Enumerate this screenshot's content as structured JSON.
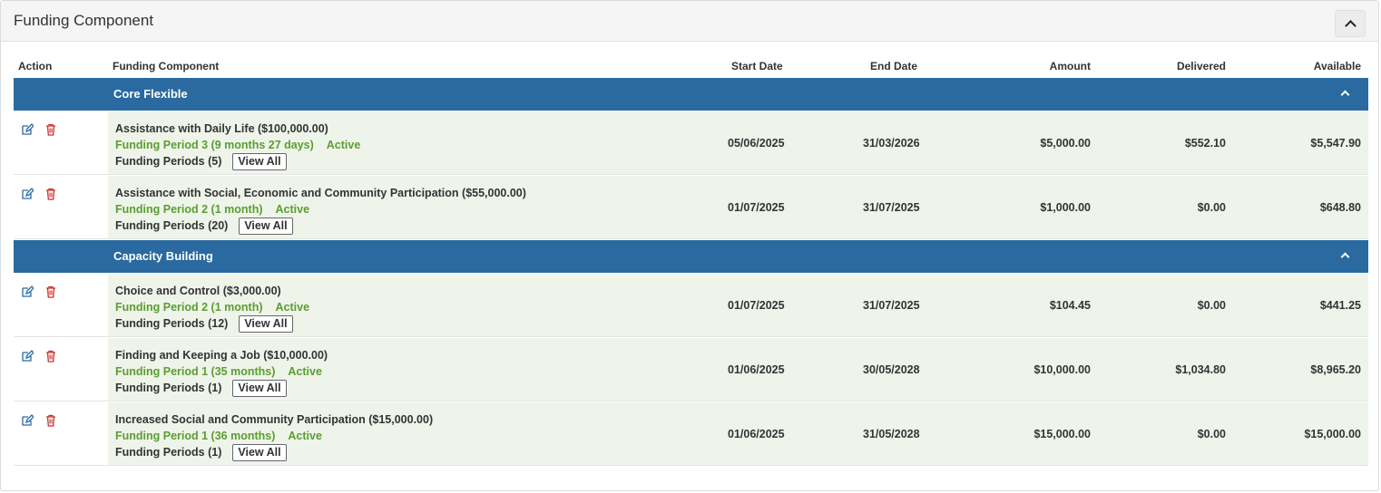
{
  "panel": {
    "title": "Funding Component"
  },
  "table": {
    "headers": {
      "action": "Action",
      "component": "Funding Component",
      "start": "Start Date",
      "end": "End Date",
      "amount": "Amount",
      "delivered": "Delivered",
      "available": "Available"
    },
    "groups": [
      {
        "label": "Core Flexible",
        "rows": [
          {
            "name": "Assistance with Daily Life ($100,000.00)",
            "period": "Funding Period 3 (9 months 27 days)",
            "status": "Active",
            "periods": "Funding Periods (5)",
            "view_all": "View All",
            "start": "05/06/2025",
            "end": "31/03/2026",
            "amount": "$5,000.00",
            "delivered": "$552.10",
            "available": "$5,547.90"
          },
          {
            "name": "Assistance with Social, Economic and Community Participation ($55,000.00)",
            "period": "Funding Period 2 (1 month)",
            "status": "Active",
            "periods": "Funding Periods (20)",
            "view_all": "View All",
            "start": "01/07/2025",
            "end": "31/07/2025",
            "amount": "$1,000.00",
            "delivered": "$0.00",
            "available": "$648.80"
          }
        ]
      },
      {
        "label": "Capacity Building",
        "rows": [
          {
            "name": "Choice and Control ($3,000.00)",
            "period": "Funding Period 2 (1 month)",
            "status": "Active",
            "periods": "Funding Periods (12)",
            "view_all": "View All",
            "start": "01/07/2025",
            "end": "31/07/2025",
            "amount": "$104.45",
            "delivered": "$0.00",
            "available": "$441.25"
          },
          {
            "name": "Finding and Keeping a Job ($10,000.00)",
            "period": "Funding Period 1 (35 months)",
            "status": "Active",
            "periods": "Funding Periods (1)",
            "view_all": "View All",
            "start": "01/06/2025",
            "end": "30/05/2028",
            "amount": "$10,000.00",
            "delivered": "$1,034.80",
            "available": "$8,965.20"
          },
          {
            "name": "Increased Social and Community Participation ($15,000.00)",
            "period": "Funding Period 1 (36 months)",
            "status": "Active",
            "periods": "Funding Periods (1)",
            "view_all": "View All",
            "start": "01/06/2025",
            "end": "31/05/2028",
            "amount": "$15,000.00",
            "delivered": "$0.00",
            "available": "$15,000.00"
          }
        ]
      }
    ]
  },
  "colors": {
    "group_header": "#2a6aa0",
    "row_bg": "#eef4ea",
    "status_green": "#5a9e2f",
    "edit_icon": "#2a6aa0",
    "delete_icon": "#c9302c"
  },
  "icons": {
    "edit": "edit-icon",
    "delete": "trash-icon",
    "collapse": "chevron-up-icon"
  }
}
